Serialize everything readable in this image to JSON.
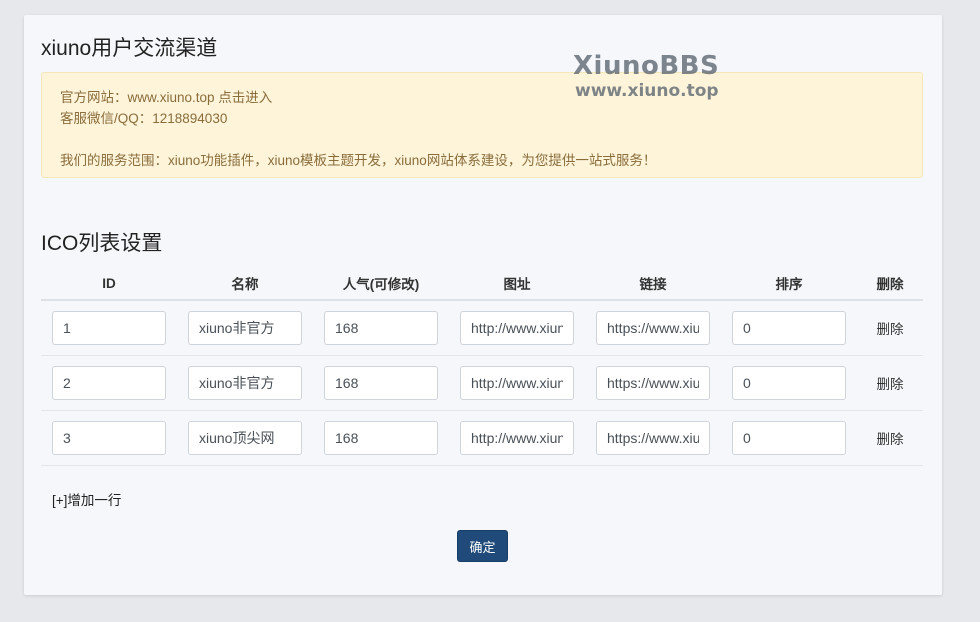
{
  "page_title": "xiuno用户交流渠道",
  "notice": {
    "line1": "官方网站：www.xiuno.top 点击进入",
    "line2": "客服微信/QQ：1218894030",
    "line3": "我们的服务范围：xiuno功能插件，xiuno模板主题开发，xiuno网站体系建设，为您提供一站式服务！"
  },
  "watermark": {
    "brand": "XiunoBBS",
    "url": "www.xiuno.top"
  },
  "section_title": "ICO列表设置",
  "table": {
    "headers": [
      "ID",
      "名称",
      "人气(可修改)",
      "图址",
      "链接",
      "排序",
      "删除"
    ],
    "rows": [
      {
        "id": "1",
        "name": "xiuno非官方",
        "popularity": "168",
        "image_url": "http://www.xiuno.top",
        "link": "https://www.xiuno.top",
        "order": "0",
        "delete_label": "删除"
      },
      {
        "id": "2",
        "name": "xiuno非官方",
        "popularity": "168",
        "image_url": "http://www.xiuno.top",
        "link": "https://www.xiuno.top",
        "order": "0",
        "delete_label": "删除"
      },
      {
        "id": "3",
        "name": "xiuno顶尖网",
        "popularity": "168",
        "image_url": "http://www.xiuno.top",
        "link": "https://www.xiuno.top",
        "order": "0",
        "delete_label": "删除"
      }
    ]
  },
  "add_row_label": "[+]增加一行",
  "submit_label": "确定"
}
